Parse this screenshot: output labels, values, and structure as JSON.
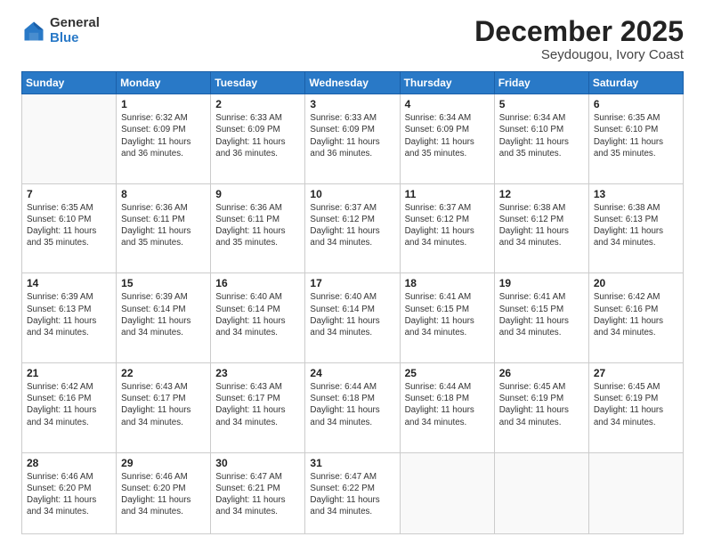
{
  "logo": {
    "general": "General",
    "blue": "Blue"
  },
  "title": {
    "month": "December 2025",
    "location": "Seydougou, Ivory Coast"
  },
  "header": {
    "days": [
      "Sunday",
      "Monday",
      "Tuesday",
      "Wednesday",
      "Thursday",
      "Friday",
      "Saturday"
    ]
  },
  "weeks": [
    [
      {
        "day": "",
        "info": ""
      },
      {
        "day": "1",
        "info": "Sunrise: 6:32 AM\nSunset: 6:09 PM\nDaylight: 11 hours\nand 36 minutes."
      },
      {
        "day": "2",
        "info": "Sunrise: 6:33 AM\nSunset: 6:09 PM\nDaylight: 11 hours\nand 36 minutes."
      },
      {
        "day": "3",
        "info": "Sunrise: 6:33 AM\nSunset: 6:09 PM\nDaylight: 11 hours\nand 36 minutes."
      },
      {
        "day": "4",
        "info": "Sunrise: 6:34 AM\nSunset: 6:09 PM\nDaylight: 11 hours\nand 35 minutes."
      },
      {
        "day": "5",
        "info": "Sunrise: 6:34 AM\nSunset: 6:10 PM\nDaylight: 11 hours\nand 35 minutes."
      },
      {
        "day": "6",
        "info": "Sunrise: 6:35 AM\nSunset: 6:10 PM\nDaylight: 11 hours\nand 35 minutes."
      }
    ],
    [
      {
        "day": "7",
        "info": "Sunrise: 6:35 AM\nSunset: 6:10 PM\nDaylight: 11 hours\nand 35 minutes."
      },
      {
        "day": "8",
        "info": "Sunrise: 6:36 AM\nSunset: 6:11 PM\nDaylight: 11 hours\nand 35 minutes."
      },
      {
        "day": "9",
        "info": "Sunrise: 6:36 AM\nSunset: 6:11 PM\nDaylight: 11 hours\nand 35 minutes."
      },
      {
        "day": "10",
        "info": "Sunrise: 6:37 AM\nSunset: 6:12 PM\nDaylight: 11 hours\nand 34 minutes."
      },
      {
        "day": "11",
        "info": "Sunrise: 6:37 AM\nSunset: 6:12 PM\nDaylight: 11 hours\nand 34 minutes."
      },
      {
        "day": "12",
        "info": "Sunrise: 6:38 AM\nSunset: 6:12 PM\nDaylight: 11 hours\nand 34 minutes."
      },
      {
        "day": "13",
        "info": "Sunrise: 6:38 AM\nSunset: 6:13 PM\nDaylight: 11 hours\nand 34 minutes."
      }
    ],
    [
      {
        "day": "14",
        "info": "Sunrise: 6:39 AM\nSunset: 6:13 PM\nDaylight: 11 hours\nand 34 minutes."
      },
      {
        "day": "15",
        "info": "Sunrise: 6:39 AM\nSunset: 6:14 PM\nDaylight: 11 hours\nand 34 minutes."
      },
      {
        "day": "16",
        "info": "Sunrise: 6:40 AM\nSunset: 6:14 PM\nDaylight: 11 hours\nand 34 minutes."
      },
      {
        "day": "17",
        "info": "Sunrise: 6:40 AM\nSunset: 6:14 PM\nDaylight: 11 hours\nand 34 minutes."
      },
      {
        "day": "18",
        "info": "Sunrise: 6:41 AM\nSunset: 6:15 PM\nDaylight: 11 hours\nand 34 minutes."
      },
      {
        "day": "19",
        "info": "Sunrise: 6:41 AM\nSunset: 6:15 PM\nDaylight: 11 hours\nand 34 minutes."
      },
      {
        "day": "20",
        "info": "Sunrise: 6:42 AM\nSunset: 6:16 PM\nDaylight: 11 hours\nand 34 minutes."
      }
    ],
    [
      {
        "day": "21",
        "info": "Sunrise: 6:42 AM\nSunset: 6:16 PM\nDaylight: 11 hours\nand 34 minutes."
      },
      {
        "day": "22",
        "info": "Sunrise: 6:43 AM\nSunset: 6:17 PM\nDaylight: 11 hours\nand 34 minutes."
      },
      {
        "day": "23",
        "info": "Sunrise: 6:43 AM\nSunset: 6:17 PM\nDaylight: 11 hours\nand 34 minutes."
      },
      {
        "day": "24",
        "info": "Sunrise: 6:44 AM\nSunset: 6:18 PM\nDaylight: 11 hours\nand 34 minutes."
      },
      {
        "day": "25",
        "info": "Sunrise: 6:44 AM\nSunset: 6:18 PM\nDaylight: 11 hours\nand 34 minutes."
      },
      {
        "day": "26",
        "info": "Sunrise: 6:45 AM\nSunset: 6:19 PM\nDaylight: 11 hours\nand 34 minutes."
      },
      {
        "day": "27",
        "info": "Sunrise: 6:45 AM\nSunset: 6:19 PM\nDaylight: 11 hours\nand 34 minutes."
      }
    ],
    [
      {
        "day": "28",
        "info": "Sunrise: 6:46 AM\nSunset: 6:20 PM\nDaylight: 11 hours\nand 34 minutes."
      },
      {
        "day": "29",
        "info": "Sunrise: 6:46 AM\nSunset: 6:20 PM\nDaylight: 11 hours\nand 34 minutes."
      },
      {
        "day": "30",
        "info": "Sunrise: 6:47 AM\nSunset: 6:21 PM\nDaylight: 11 hours\nand 34 minutes."
      },
      {
        "day": "31",
        "info": "Sunrise: 6:47 AM\nSunset: 6:22 PM\nDaylight: 11 hours\nand 34 minutes."
      },
      {
        "day": "",
        "info": ""
      },
      {
        "day": "",
        "info": ""
      },
      {
        "day": "",
        "info": ""
      }
    ]
  ]
}
